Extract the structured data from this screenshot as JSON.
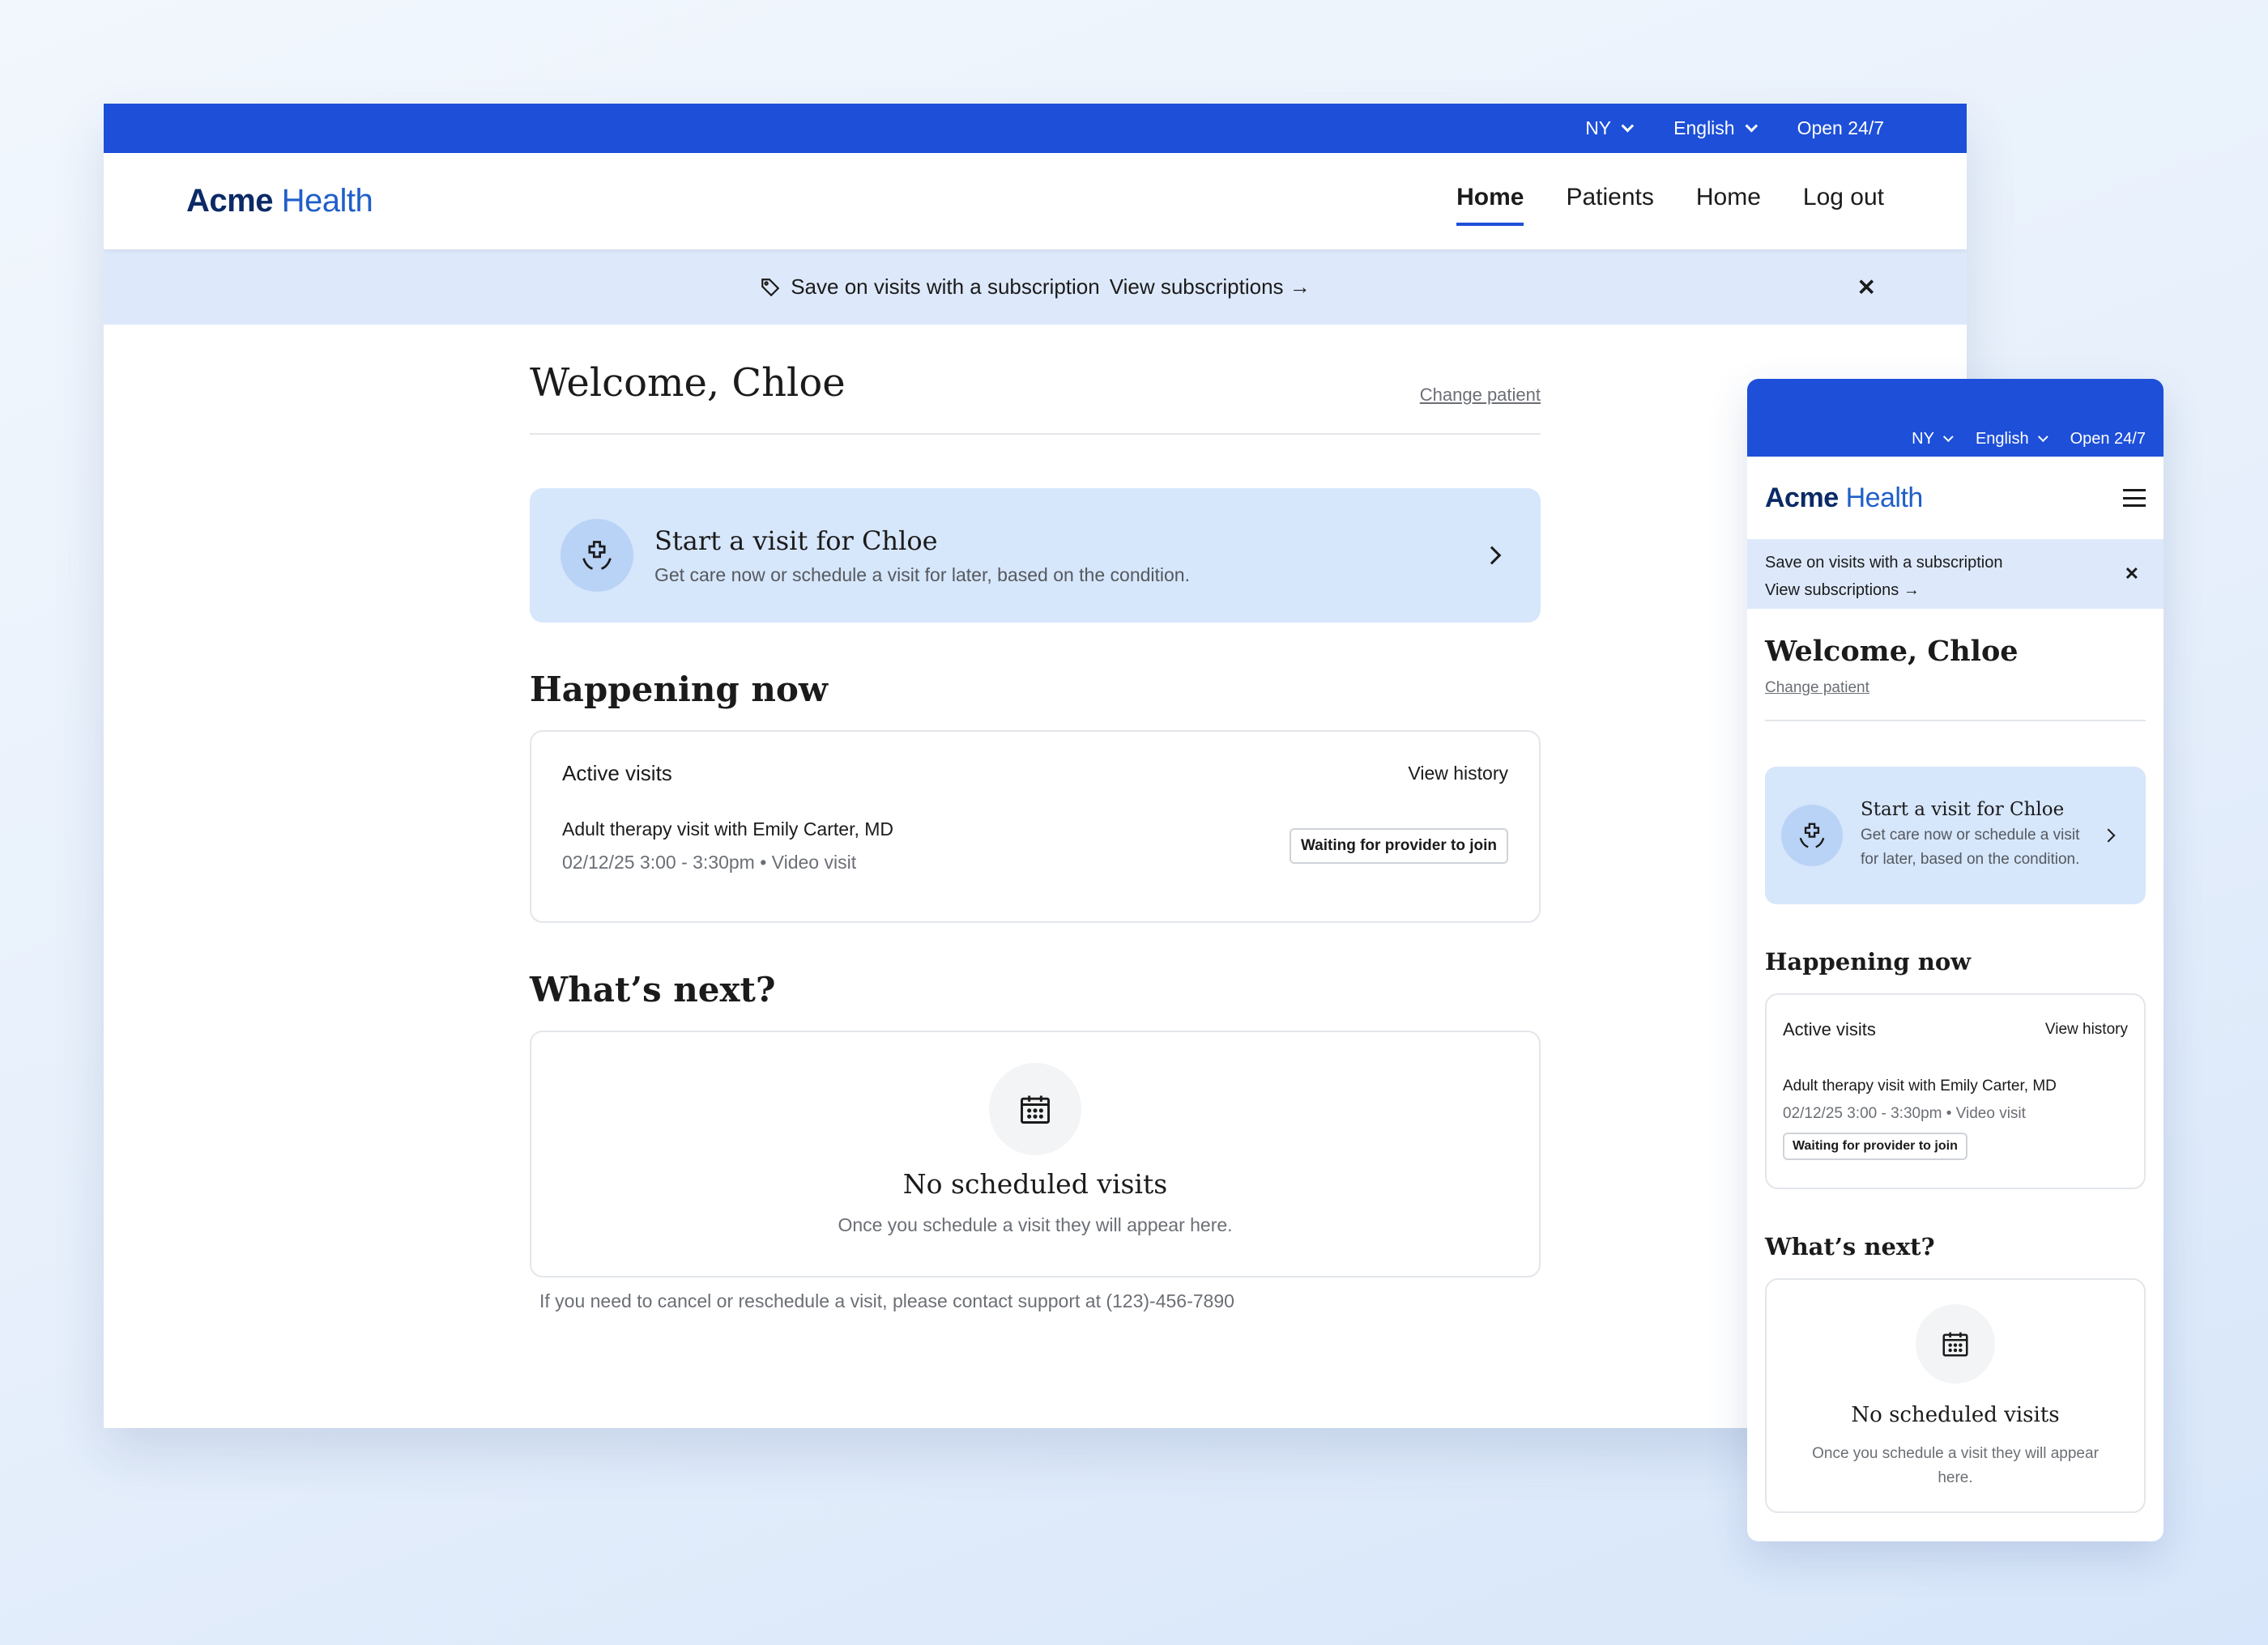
{
  "top_bar": {
    "region": "NY",
    "language": "English",
    "hours": "Open 24/7"
  },
  "brand": {
    "bold": "Acme",
    "light": "Health",
    "color": "#1d4fd8"
  },
  "nav": {
    "items": [
      {
        "label": "Home",
        "active": true
      },
      {
        "label": "Patients",
        "active": false
      },
      {
        "label": "Home",
        "active": false
      },
      {
        "label": "Log out",
        "active": false
      }
    ]
  },
  "promo": {
    "text": "Save on visits with a subscription",
    "link": "View subscriptions →",
    "close": "✕",
    "icon": "tag-icon"
  },
  "welcome": {
    "title": "Welcome, Chloe",
    "change_patient": "Change patient"
  },
  "start_visit": {
    "title": "Start a visit for Chloe",
    "subtitle": "Get care now or schedule a visit for later, based on the condition.",
    "icon": "caring-hands-icon"
  },
  "happening_now": {
    "title": "Happening now",
    "card_title": "Active visits",
    "view_history": "View history",
    "visit": {
      "title": "Adult therapy visit with Emily Carter, MD",
      "meta": "02/12/25 3:00 - 3:30pm • Video visit",
      "status": "Waiting for provider to join"
    }
  },
  "whats_next": {
    "title": "What’s next?",
    "empty_title": "No scheduled visits",
    "empty_subtitle": "Once you schedule a visit they will appear here.",
    "icon": "calendar-icon"
  },
  "support_note": "If you need to cancel or reschedule a visit, please contact support at (123)-456-7890"
}
